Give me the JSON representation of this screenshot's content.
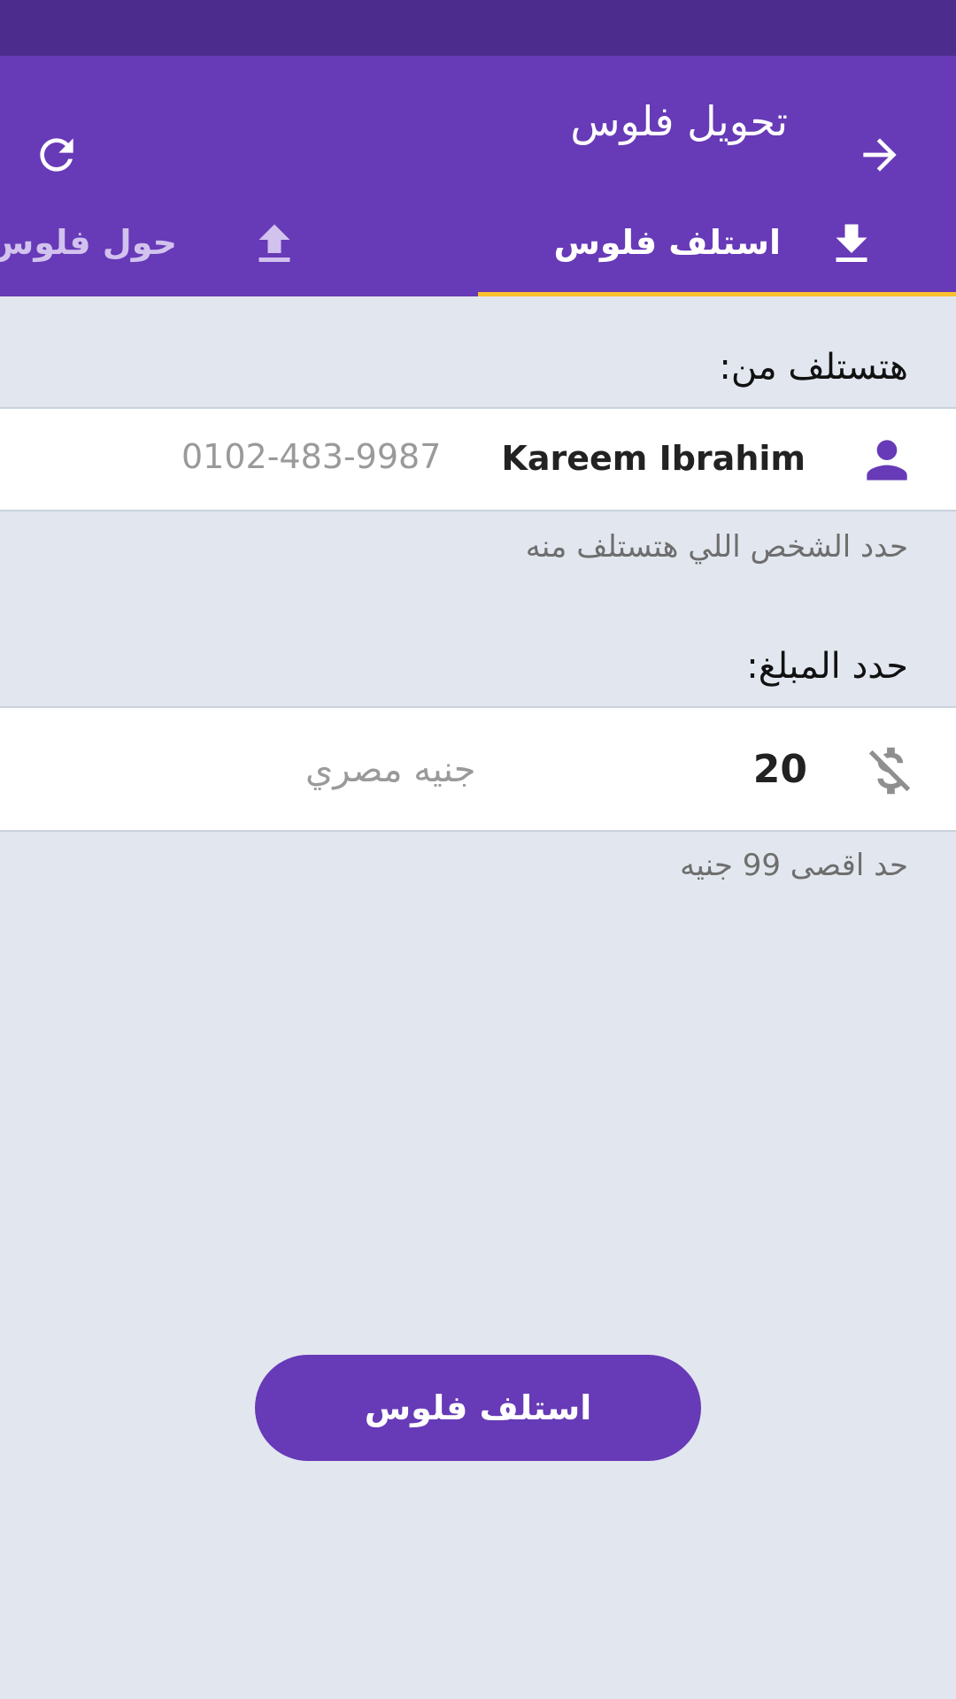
{
  "colors": {
    "primary": "#673ab7",
    "status_bar": "#4c2d8d",
    "tab_indicator": "#fbc02d",
    "background": "#e2e7ef"
  },
  "app_bar": {
    "title": "تحويل فلوس",
    "back_icon": "arrow-right-icon",
    "refresh_icon": "refresh-icon"
  },
  "tabs": [
    {
      "label": "استلف فلوس",
      "icon": "download-icon",
      "selected": true
    },
    {
      "label": "حول فلوس",
      "icon": "upload-icon",
      "selected": false
    }
  ],
  "receive_from": {
    "label": "هتستلف من:",
    "contact_name": "Kareem Ibrahim",
    "contact_phone": "0102-483-9987",
    "helper": "حدد الشخص اللي هتستلف منه",
    "icon": "person-icon"
  },
  "amount": {
    "label": "حدد المبلغ:",
    "value": "20",
    "currency": "جنيه مصري",
    "helper": "حد اقصى 99 جنيه",
    "icon": "money-off-icon"
  },
  "submit_label": "استلف فلوس"
}
